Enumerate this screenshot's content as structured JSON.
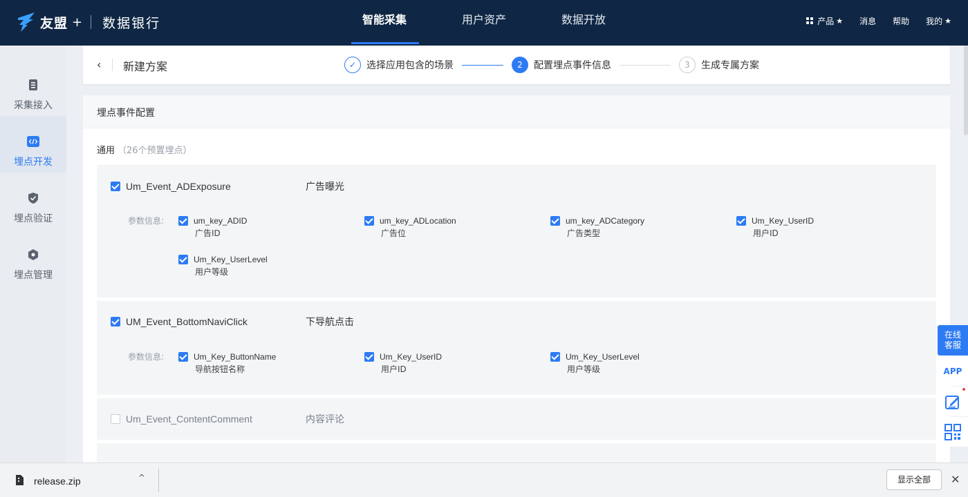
{
  "brand": {
    "name": "友盟",
    "plus": "+",
    "product": "数据银行"
  },
  "topnav": [
    {
      "label": "智能采集",
      "active": true
    },
    {
      "label": "用户资产",
      "active": false
    },
    {
      "label": "数据开放",
      "active": false
    }
  ],
  "toolbar": {
    "products": "产品",
    "products_star": "★",
    "messages": "消息",
    "help": "帮助",
    "mine": "我的",
    "mine_star": "★"
  },
  "sidebar": [
    {
      "label": "采集接入",
      "icon": "document-icon",
      "active": false
    },
    {
      "label": "埋点开发",
      "icon": "code-icon",
      "active": true
    },
    {
      "label": "埋点验证",
      "icon": "shield-check-icon",
      "active": false
    },
    {
      "label": "埋点管理",
      "icon": "hexagon-gear-icon",
      "active": false
    }
  ],
  "header": {
    "back_icon": "‹",
    "title": "新建方案",
    "steps": [
      {
        "mark": "✓",
        "label": "选择应用包含的场景",
        "state": "done"
      },
      {
        "mark": "2",
        "label": "配置埋点事件信息",
        "state": "current"
      },
      {
        "mark": "3",
        "label": "生成专属方案",
        "state": "todo"
      }
    ]
  },
  "config": {
    "heading": "埋点事件配置",
    "group": {
      "name": "通用",
      "count": "（26个预置埋点）"
    },
    "param_label": "参数信息:",
    "events": [
      {
        "key": "Um_Event_ADExposure",
        "cn": "广告曝光",
        "checked": true,
        "params": [
          {
            "key": "um_key_ADID",
            "cn": "广告ID",
            "checked": true
          },
          {
            "key": "um_key_ADLocation",
            "cn": "广告位",
            "checked": true
          },
          {
            "key": "um_key_ADCategory",
            "cn": "广告类型",
            "checked": true
          },
          {
            "key": "Um_Key_UserID",
            "cn": "用户ID",
            "checked": true
          },
          {
            "key": "Um_Key_UserLevel",
            "cn": "用户等级",
            "checked": true
          }
        ]
      },
      {
        "key": "UM_Event_BottomNaviClick",
        "cn": "下导航点击",
        "checked": true,
        "params": [
          {
            "key": "Um_Key_ButtonName",
            "cn": "导航按钮名称",
            "checked": true
          },
          {
            "key": "Um_Key_UserID",
            "cn": "用户ID",
            "checked": true
          },
          {
            "key": "Um_Key_UserLevel",
            "cn": "用户等级",
            "checked": true
          }
        ]
      },
      {
        "key": "Um_Event_ContentComment",
        "cn": "内容评论",
        "checked": false,
        "params": []
      }
    ]
  },
  "float_rail": {
    "service": "在线\n客服",
    "app": "APP",
    "feedback_icon": "edit-icon",
    "qr_icon": "qrcode-icon"
  },
  "download_bar": {
    "file_name": "release.zip",
    "caret": "^",
    "show_all": "显示全部",
    "close": "✕"
  },
  "colors": {
    "nav_bg": "#0f2744",
    "accent": "#2d7bf4"
  }
}
